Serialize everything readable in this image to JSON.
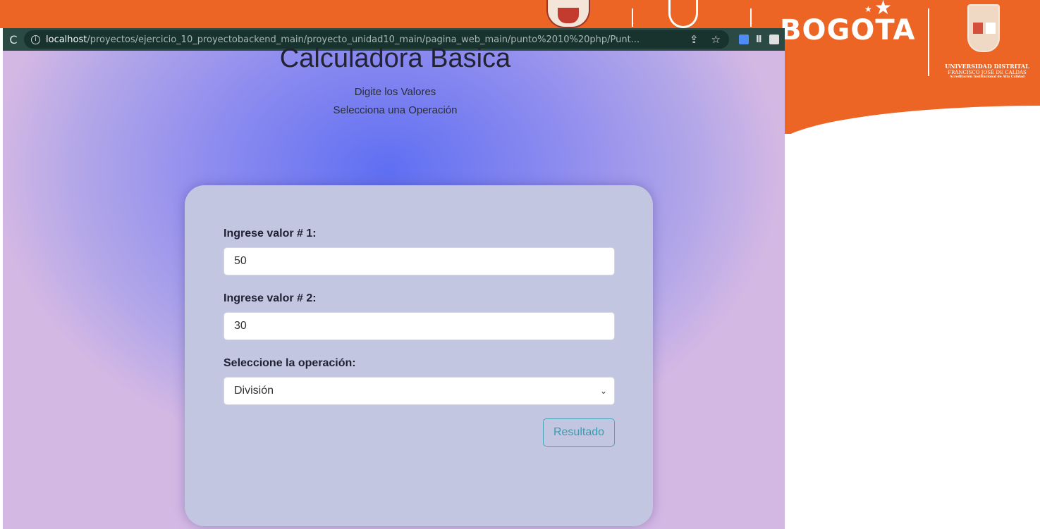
{
  "slide": {
    "brand_text": "BOGOTA",
    "university_line1": "UNIVERSIDAD DISTRITAL",
    "university_line2": "FRANCISCO JOSÉ DE CALDAS",
    "university_line3": "Acreditación Institucional de Alta Calidad",
    "accent_color": "#ec6525"
  },
  "browser": {
    "url_host": "localhost",
    "url_path": "/proyectos/ejercicio_10_proyectobackend_main/proyecto_unidad10_main/pagina_web_main/punto%2010%20php/Punt...",
    "icons": [
      "reload-icon",
      "info-icon",
      "share-icon",
      "star-icon"
    ]
  },
  "page": {
    "title": "Calculadora Basica",
    "subtitle1": "Digite los Valores",
    "subtitle2": "Selecciona una Operación"
  },
  "form": {
    "label1": "Ingrese valor # 1:",
    "value1": "50",
    "label2": "Ingrese valor # 2:",
    "value2": "30",
    "label3": "Seleccione la operación:",
    "operation": "División",
    "submit_label": "Resultado"
  }
}
